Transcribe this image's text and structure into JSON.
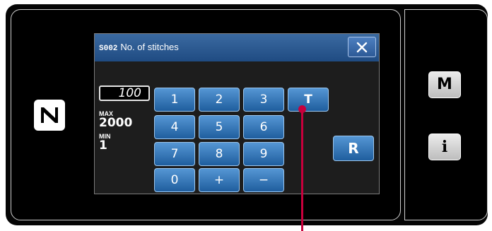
{
  "dialog": {
    "code": "S002",
    "title": "No. of stitches"
  },
  "entry": {
    "value": "100",
    "max_label": "MAX",
    "max_value": "2000",
    "min_label": "MIN",
    "min_value": "1"
  },
  "keypad": {
    "keys": [
      "1",
      "2",
      "3",
      "T",
      "4",
      "5",
      "6",
      "7",
      "8",
      "9",
      "0",
      "+",
      "−"
    ],
    "reset_label": "R"
  },
  "side": {
    "mode_label": "M",
    "info_label": "i"
  },
  "icons": {
    "close": "close-x-icon",
    "nfc": "nfc-icon"
  },
  "colors": {
    "key_blue": "#2f72b6",
    "header_blue": "#2a5a94",
    "callout": "#c8003c"
  }
}
